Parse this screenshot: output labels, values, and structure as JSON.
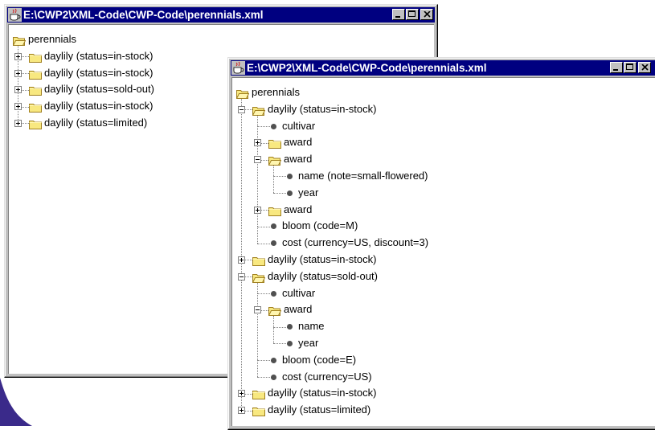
{
  "windows": [
    {
      "title": "E:\\CWP2\\XML-Code\\CWP-Code\\perennials.xml",
      "root_label": "perennials",
      "nodes": [
        {
          "label": "daylily (status=in-stock)",
          "depth": 1,
          "kind": "folder",
          "state": "collapsed"
        },
        {
          "label": "daylily (status=in-stock)",
          "depth": 1,
          "kind": "folder",
          "state": "collapsed"
        },
        {
          "label": "daylily (status=sold-out)",
          "depth": 1,
          "kind": "folder",
          "state": "collapsed"
        },
        {
          "label": "daylily (status=in-stock)",
          "depth": 1,
          "kind": "folder",
          "state": "collapsed"
        },
        {
          "label": "daylily (status=limited)",
          "depth": 1,
          "kind": "folder",
          "state": "collapsed"
        }
      ]
    },
    {
      "title": "E:\\CWP2\\XML-Code\\CWP-Code\\perennials.xml",
      "root_label": "perennials",
      "nodes": [
        {
          "label": "daylily (status=in-stock)",
          "depth": 1,
          "kind": "folder",
          "state": "expanded"
        },
        {
          "label": "cultivar",
          "depth": 2,
          "kind": "leaf"
        },
        {
          "label": "award",
          "depth": 2,
          "kind": "folder",
          "state": "collapsed"
        },
        {
          "label": "award",
          "depth": 2,
          "kind": "folder",
          "state": "expanded"
        },
        {
          "label": "name (note=small-flowered)",
          "depth": 3,
          "kind": "leaf"
        },
        {
          "label": "year",
          "depth": 3,
          "kind": "leaf"
        },
        {
          "label": "award",
          "depth": 2,
          "kind": "folder",
          "state": "collapsed"
        },
        {
          "label": "bloom (code=M)",
          "depth": 2,
          "kind": "leaf"
        },
        {
          "label": "cost (currency=US, discount=3)",
          "depth": 2,
          "kind": "leaf"
        },
        {
          "label": "daylily (status=in-stock)",
          "depth": 1,
          "kind": "folder",
          "state": "collapsed"
        },
        {
          "label": "daylily (status=sold-out)",
          "depth": 1,
          "kind": "folder",
          "state": "expanded"
        },
        {
          "label": "cultivar",
          "depth": 2,
          "kind": "leaf"
        },
        {
          "label": "award",
          "depth": 2,
          "kind": "folder",
          "state": "expanded"
        },
        {
          "label": "name",
          "depth": 3,
          "kind": "leaf"
        },
        {
          "label": "year",
          "depth": 3,
          "kind": "leaf"
        },
        {
          "label": "bloom (code=E)",
          "depth": 2,
          "kind": "leaf"
        },
        {
          "label": "cost (currency=US)",
          "depth": 2,
          "kind": "leaf"
        },
        {
          "label": "daylily (status=in-stock)",
          "depth": 1,
          "kind": "folder",
          "state": "collapsed"
        },
        {
          "label": "daylily (status=limited)",
          "depth": 1,
          "kind": "folder",
          "state": "collapsed"
        }
      ]
    }
  ],
  "colors": {
    "titlebar": "#000080",
    "folder_fill": "#f8e880",
    "folder_edge": "#a08020",
    "window_face": "#c0c0c0",
    "background_swoosh": "#3a2a8a"
  },
  "icons": {
    "app_icon": "java-coffee-icon",
    "minimize": "minimize-icon",
    "maximize": "maximize-icon",
    "close": "close-icon"
  }
}
